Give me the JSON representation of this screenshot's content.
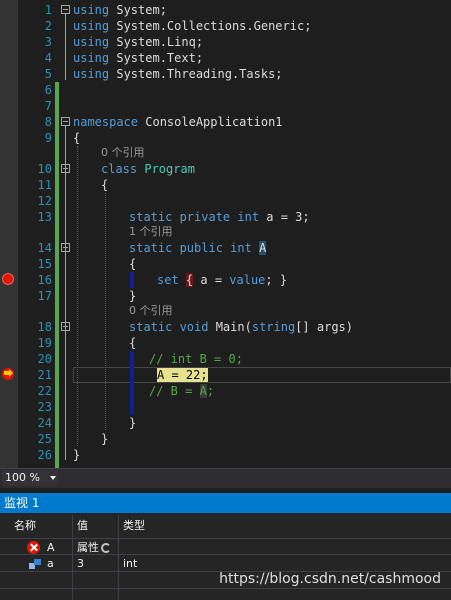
{
  "editor": {
    "line_numbers": [
      "1",
      "2",
      "3",
      "4",
      "5",
      "6",
      "7",
      "8",
      "9",
      "10",
      "11",
      "12",
      "13",
      "14",
      "15",
      "16",
      "17",
      "18",
      "19",
      "20",
      "21",
      "22",
      "23",
      "24",
      "25",
      "26"
    ],
    "lines": {
      "l1_kw": "using",
      "l1_rest": " System;",
      "l2_kw": "using",
      "l2_rest": " System.Collections.Generic;",
      "l3_kw": "using",
      "l3_rest": " System.Linq;",
      "l4_kw": "using",
      "l4_rest": " System.Text;",
      "l5_kw": "using",
      "l5_rest": " System.Threading.Tasks;",
      "l8_kw": "namespace",
      "l8_rest": " ConsoleApplication1",
      "l9": "{",
      "l10_kw": "class",
      "l10_ty": " Program",
      "l11": "{",
      "l13_kw": "static private int",
      "l13_rest": " a = 3;",
      "l14_kw": "static public int",
      "l14_a": "A",
      "l15": "{",
      "l16_kw": "set",
      "l16_open": "{",
      "l16_mid": " a = ",
      "l16_kw2": "value",
      "l16_end": "; }",
      "l17": "}",
      "l18_kw": "static void",
      "l18_name": " Main(",
      "l18_kw2": "string",
      "l18_end": "[] args)",
      "l19": "{",
      "l20": "// int B = 0;",
      "l21": "A = 22;",
      "l22_a": "// B = ",
      "l22_b": "A",
      "l22_c": ";",
      "l24": "}",
      "l25": "}",
      "l26": "}"
    },
    "codelens": {
      "class_refs": "0 个引用",
      "prop_refs": "1 个引用",
      "main_refs": "0 个引用"
    }
  },
  "statusbar": {
    "zoom": "100 %"
  },
  "watch": {
    "title": "监视 1",
    "columns": {
      "name": "名称",
      "value": "值",
      "type": "类型"
    },
    "rows": [
      {
        "name": "A",
        "value": "属性",
        "type": "",
        "icon": "error-icon"
      },
      {
        "name": "a",
        "value": "3",
        "type": "int",
        "icon": "field-icon"
      }
    ]
  },
  "watermark": "https://blog.csdn.net/cashmood",
  "colors": {
    "keyword": "#569cd6",
    "type": "#4ec9b0",
    "comment": "#57a64a",
    "line_number": "#2b91af",
    "accent": "#007acc",
    "breakpoint": "#e51400"
  }
}
